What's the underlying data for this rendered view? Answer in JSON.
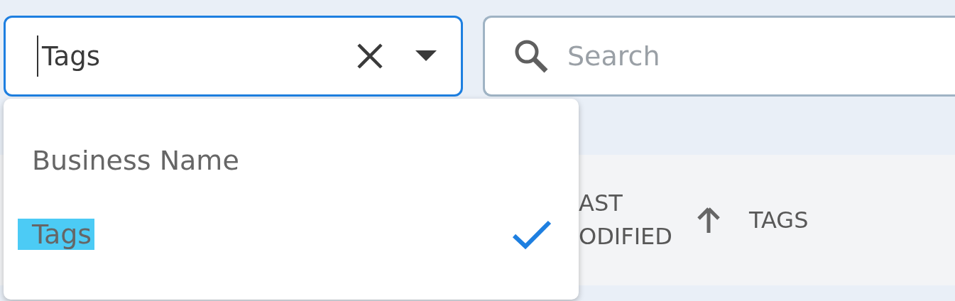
{
  "filter_select": {
    "value": "Tags",
    "focused": true,
    "options": [
      {
        "label": "Business Name",
        "selected": false,
        "highlighted": false
      },
      {
        "label": "Tags",
        "selected": true,
        "highlighted": true
      }
    ]
  },
  "search": {
    "placeholder": "Search"
  },
  "table": {
    "columns": [
      {
        "lines": [
          "AST",
          "ODIFIED"
        ],
        "sorted_ascending": true
      },
      {
        "lines": [
          "TAGS"
        ],
        "sorted_ascending": false
      }
    ]
  }
}
